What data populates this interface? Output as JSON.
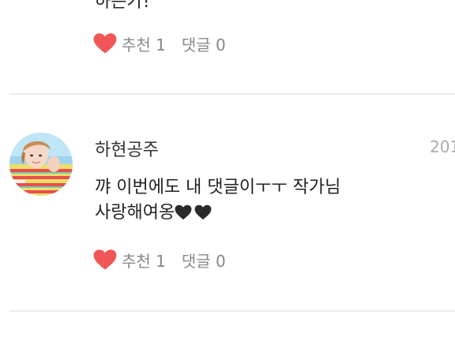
{
  "comments": [
    {
      "text_tail": "하는가!",
      "likes_label": "추천 1",
      "replies_label": "댓글 0",
      "heart_icon": "heart-icon",
      "heart_color": "#f05656"
    },
    {
      "author": "하현공주",
      "timestamp": "201",
      "text": "꺄 이번에도 내 댓글이ㅜㅜ 작가님\n사랑해여옹",
      "text_emoji": [
        "black-heart-icon",
        "black-heart-icon"
      ],
      "likes_label": "추천 1",
      "replies_label": "댓글 0",
      "heart_icon": "heart-icon",
      "heart_color": "#f05656"
    }
  ]
}
